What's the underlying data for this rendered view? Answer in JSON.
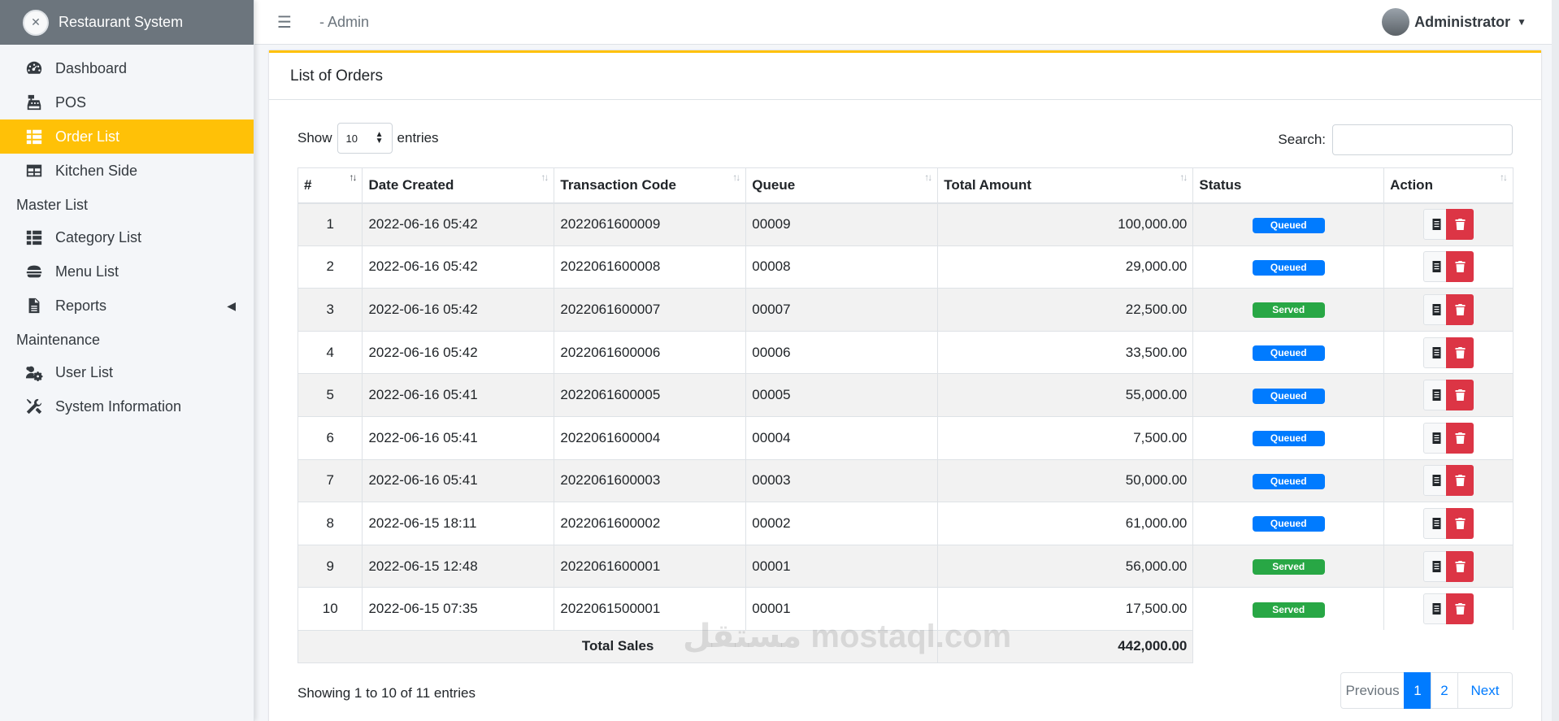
{
  "sidebar": {
    "brand": "Restaurant System",
    "items_main": [
      {
        "label": "Dashboard",
        "icon": "tachometer-icon"
      },
      {
        "label": "POS",
        "icon": "cash-register-icon"
      },
      {
        "label": "Order List",
        "icon": "table-list-icon"
      },
      {
        "label": "Kitchen Side",
        "icon": "table-icon"
      }
    ],
    "header_master": "Master List",
    "items_master": [
      {
        "label": "Category List",
        "icon": "list-icon"
      },
      {
        "label": "Menu List",
        "icon": "hamburger-food-icon"
      },
      {
        "label": "Reports",
        "icon": "file-icon"
      }
    ],
    "header_maint": "Maintenance",
    "items_maint": [
      {
        "label": "User List",
        "icon": "users-cog-icon"
      },
      {
        "label": "System Information",
        "icon": "tools-icon"
      }
    ]
  },
  "topbar": {
    "title": "- Admin",
    "user": "Administrator"
  },
  "card": {
    "title": "List of Orders",
    "show_label": "Show",
    "entries_value": "10",
    "entries_label": "entries",
    "search_label": "Search:"
  },
  "table": {
    "headers": [
      "#",
      "Date Created",
      "Transaction Code",
      "Queue",
      "Total Amount",
      "Status",
      "Action"
    ],
    "rows": [
      {
        "n": "1",
        "date": "2022-06-16 05:42",
        "code": "2022061600009",
        "queue": "00009",
        "amount": "100,000.00",
        "status": "Queued"
      },
      {
        "n": "2",
        "date": "2022-06-16 05:42",
        "code": "2022061600008",
        "queue": "00008",
        "amount": "29,000.00",
        "status": "Queued"
      },
      {
        "n": "3",
        "date": "2022-06-16 05:42",
        "code": "2022061600007",
        "queue": "00007",
        "amount": "22,500.00",
        "status": "Served"
      },
      {
        "n": "4",
        "date": "2022-06-16 05:42",
        "code": "2022061600006",
        "queue": "00006",
        "amount": "33,500.00",
        "status": "Queued"
      },
      {
        "n": "5",
        "date": "2022-06-16 05:41",
        "code": "2022061600005",
        "queue": "00005",
        "amount": "55,000.00",
        "status": "Queued"
      },
      {
        "n": "6",
        "date": "2022-06-16 05:41",
        "code": "2022061600004",
        "queue": "00004",
        "amount": "7,500.00",
        "status": "Queued"
      },
      {
        "n": "7",
        "date": "2022-06-16 05:41",
        "code": "2022061600003",
        "queue": "00003",
        "amount": "50,000.00",
        "status": "Queued"
      },
      {
        "n": "8",
        "date": "2022-06-15 18:11",
        "code": "2022061600002",
        "queue": "00002",
        "amount": "61,000.00",
        "status": "Queued"
      },
      {
        "n": "9",
        "date": "2022-06-15 12:48",
        "code": "2022061600001",
        "queue": "00001",
        "amount": "56,000.00",
        "status": "Served"
      },
      {
        "n": "10",
        "date": "2022-06-15 07:35",
        "code": "2022061500001",
        "queue": "00001",
        "amount": "17,500.00",
        "status": "Served"
      }
    ],
    "footer_label": "Total Sales",
    "footer_total": "442,000.00"
  },
  "footer": {
    "info": "Showing 1 to 10 of 11 entries",
    "prev": "Previous",
    "pages": [
      "1",
      "2"
    ],
    "next": "Next"
  },
  "watermark": "مستقل mostaql.com",
  "colors": {
    "accent": "#ffc107",
    "queued": "#007bff",
    "served": "#28a745",
    "danger": "#dc3545",
    "brand_bar": "#6c757d"
  }
}
